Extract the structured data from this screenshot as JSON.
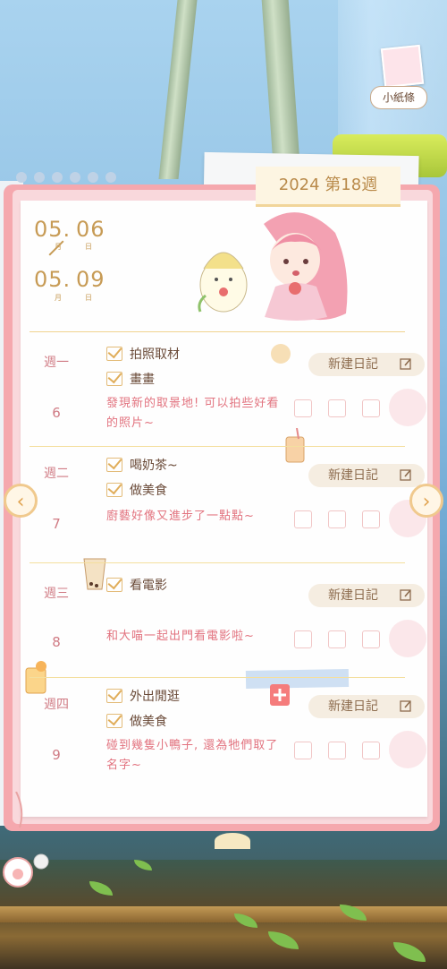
{
  "note_tag": {
    "label": "小紙條"
  },
  "week_header": {
    "label": "2024 第18週"
  },
  "date_range": {
    "start_month": "05",
    "start_day": "06",
    "end_month": "05",
    "end_day": "09",
    "month_unit": "月",
    "day_unit": "日",
    "separator": "."
  },
  "new_entry_label": "新建日記",
  "days": [
    {
      "name": "週一",
      "num": "6",
      "tasks": [
        "拍照取材",
        "畫畫"
      ],
      "diary": "發現新的取景地! 可以拍些好看的照片~"
    },
    {
      "name": "週二",
      "num": "7",
      "tasks": [
        "喝奶茶~",
        "做美食"
      ],
      "diary": "廚藝好像又進步了一點點~"
    },
    {
      "name": "週三",
      "num": "8",
      "tasks": [
        "看電影"
      ],
      "diary": "和大喵一起出門看電影啦~"
    },
    {
      "name": "週四",
      "num": "9",
      "tasks": [
        "外出閒逛",
        "做美食"
      ],
      "diary": "碰到幾隻小鴨子, 還為牠們取了名字~"
    }
  ],
  "nav": {
    "prev": "‹",
    "next": "›"
  },
  "colors": {
    "frame": "#f5a8ae",
    "accent": "#c79b55",
    "diary_text": "#e2737f"
  }
}
